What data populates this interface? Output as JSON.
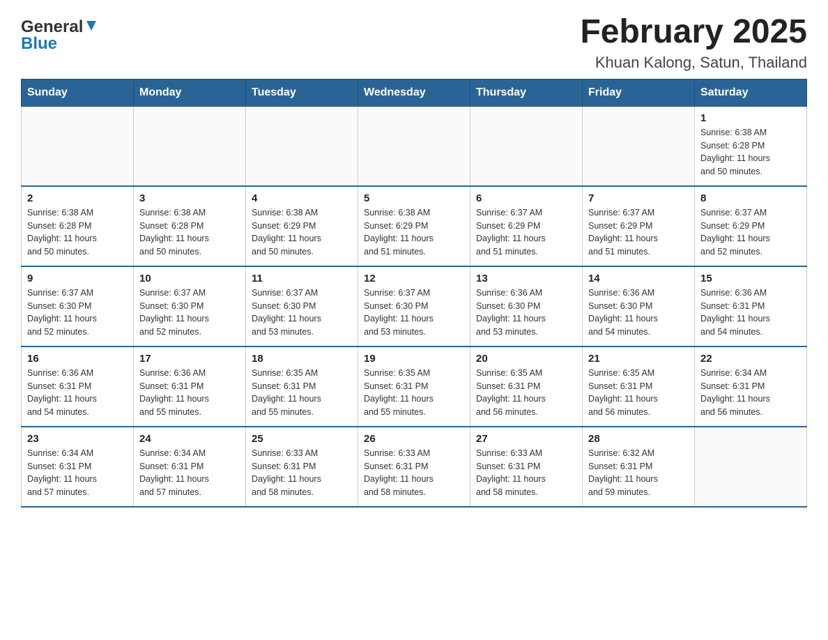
{
  "header": {
    "logo_general": "General",
    "logo_blue": "Blue",
    "title": "February 2025",
    "subtitle": "Khuan Kalong, Satun, Thailand"
  },
  "weekdays": [
    "Sunday",
    "Monday",
    "Tuesday",
    "Wednesday",
    "Thursday",
    "Friday",
    "Saturday"
  ],
  "weeks": [
    [
      {
        "day": "",
        "info": ""
      },
      {
        "day": "",
        "info": ""
      },
      {
        "day": "",
        "info": ""
      },
      {
        "day": "",
        "info": ""
      },
      {
        "day": "",
        "info": ""
      },
      {
        "day": "",
        "info": ""
      },
      {
        "day": "1",
        "info": "Sunrise: 6:38 AM\nSunset: 6:28 PM\nDaylight: 11 hours\nand 50 minutes."
      }
    ],
    [
      {
        "day": "2",
        "info": "Sunrise: 6:38 AM\nSunset: 6:28 PM\nDaylight: 11 hours\nand 50 minutes."
      },
      {
        "day": "3",
        "info": "Sunrise: 6:38 AM\nSunset: 6:28 PM\nDaylight: 11 hours\nand 50 minutes."
      },
      {
        "day": "4",
        "info": "Sunrise: 6:38 AM\nSunset: 6:29 PM\nDaylight: 11 hours\nand 50 minutes."
      },
      {
        "day": "5",
        "info": "Sunrise: 6:38 AM\nSunset: 6:29 PM\nDaylight: 11 hours\nand 51 minutes."
      },
      {
        "day": "6",
        "info": "Sunrise: 6:37 AM\nSunset: 6:29 PM\nDaylight: 11 hours\nand 51 minutes."
      },
      {
        "day": "7",
        "info": "Sunrise: 6:37 AM\nSunset: 6:29 PM\nDaylight: 11 hours\nand 51 minutes."
      },
      {
        "day": "8",
        "info": "Sunrise: 6:37 AM\nSunset: 6:29 PM\nDaylight: 11 hours\nand 52 minutes."
      }
    ],
    [
      {
        "day": "9",
        "info": "Sunrise: 6:37 AM\nSunset: 6:30 PM\nDaylight: 11 hours\nand 52 minutes."
      },
      {
        "day": "10",
        "info": "Sunrise: 6:37 AM\nSunset: 6:30 PM\nDaylight: 11 hours\nand 52 minutes."
      },
      {
        "day": "11",
        "info": "Sunrise: 6:37 AM\nSunset: 6:30 PM\nDaylight: 11 hours\nand 53 minutes."
      },
      {
        "day": "12",
        "info": "Sunrise: 6:37 AM\nSunset: 6:30 PM\nDaylight: 11 hours\nand 53 minutes."
      },
      {
        "day": "13",
        "info": "Sunrise: 6:36 AM\nSunset: 6:30 PM\nDaylight: 11 hours\nand 53 minutes."
      },
      {
        "day": "14",
        "info": "Sunrise: 6:36 AM\nSunset: 6:30 PM\nDaylight: 11 hours\nand 54 minutes."
      },
      {
        "day": "15",
        "info": "Sunrise: 6:36 AM\nSunset: 6:31 PM\nDaylight: 11 hours\nand 54 minutes."
      }
    ],
    [
      {
        "day": "16",
        "info": "Sunrise: 6:36 AM\nSunset: 6:31 PM\nDaylight: 11 hours\nand 54 minutes."
      },
      {
        "day": "17",
        "info": "Sunrise: 6:36 AM\nSunset: 6:31 PM\nDaylight: 11 hours\nand 55 minutes."
      },
      {
        "day": "18",
        "info": "Sunrise: 6:35 AM\nSunset: 6:31 PM\nDaylight: 11 hours\nand 55 minutes."
      },
      {
        "day": "19",
        "info": "Sunrise: 6:35 AM\nSunset: 6:31 PM\nDaylight: 11 hours\nand 55 minutes."
      },
      {
        "day": "20",
        "info": "Sunrise: 6:35 AM\nSunset: 6:31 PM\nDaylight: 11 hours\nand 56 minutes."
      },
      {
        "day": "21",
        "info": "Sunrise: 6:35 AM\nSunset: 6:31 PM\nDaylight: 11 hours\nand 56 minutes."
      },
      {
        "day": "22",
        "info": "Sunrise: 6:34 AM\nSunset: 6:31 PM\nDaylight: 11 hours\nand 56 minutes."
      }
    ],
    [
      {
        "day": "23",
        "info": "Sunrise: 6:34 AM\nSunset: 6:31 PM\nDaylight: 11 hours\nand 57 minutes."
      },
      {
        "day": "24",
        "info": "Sunrise: 6:34 AM\nSunset: 6:31 PM\nDaylight: 11 hours\nand 57 minutes."
      },
      {
        "day": "25",
        "info": "Sunrise: 6:33 AM\nSunset: 6:31 PM\nDaylight: 11 hours\nand 58 minutes."
      },
      {
        "day": "26",
        "info": "Sunrise: 6:33 AM\nSunset: 6:31 PM\nDaylight: 11 hours\nand 58 minutes."
      },
      {
        "day": "27",
        "info": "Sunrise: 6:33 AM\nSunset: 6:31 PM\nDaylight: 11 hours\nand 58 minutes."
      },
      {
        "day": "28",
        "info": "Sunrise: 6:32 AM\nSunset: 6:31 PM\nDaylight: 11 hours\nand 59 minutes."
      },
      {
        "day": "",
        "info": ""
      }
    ]
  ]
}
